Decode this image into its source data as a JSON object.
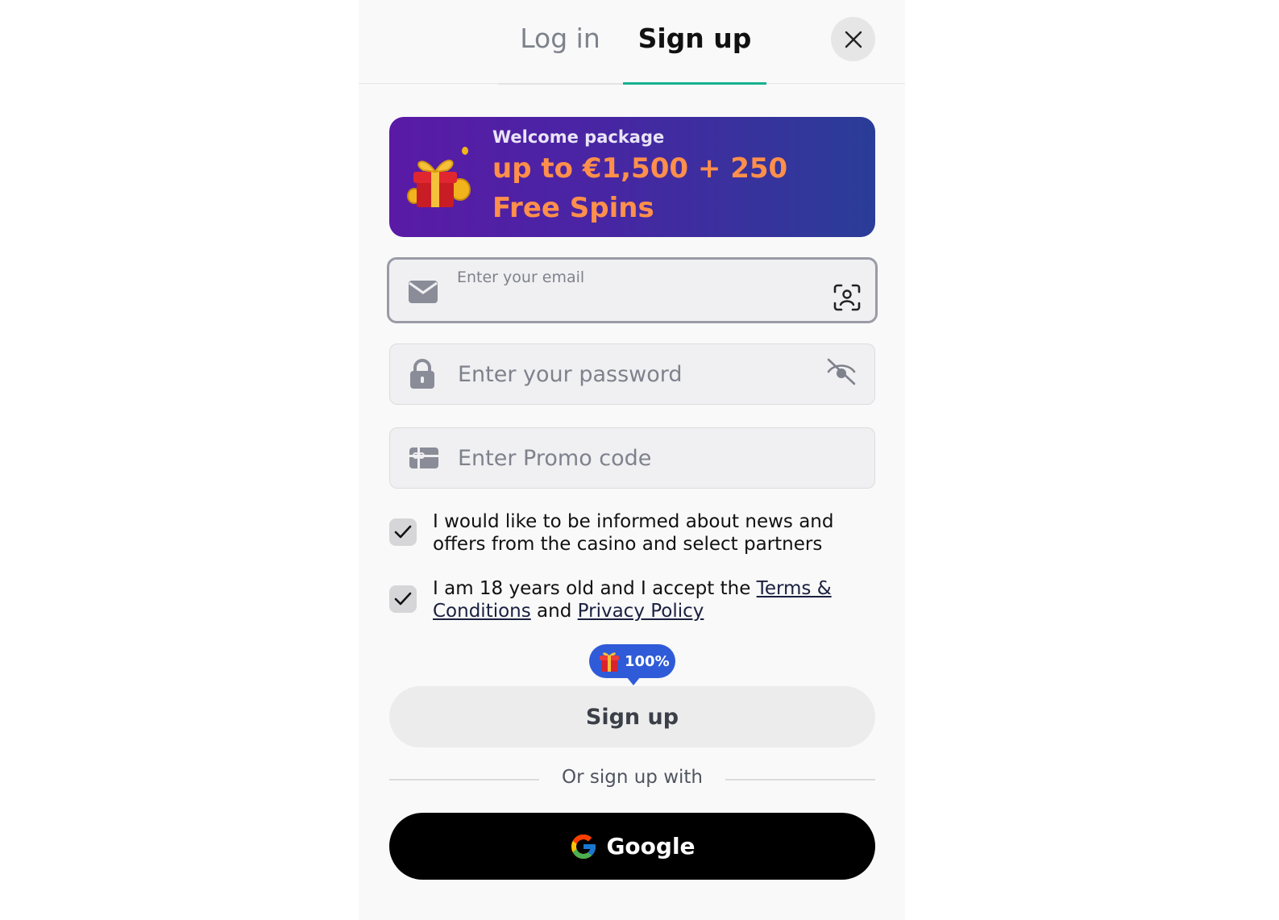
{
  "tabs": {
    "login_label": "Log in",
    "signup_label": "Sign up"
  },
  "banner": {
    "kicker": "Welcome package",
    "headline": "up to €1,500 + 250 Free Spins"
  },
  "email": {
    "label": "Enter your email",
    "value": ""
  },
  "password": {
    "placeholder": "Enter your password"
  },
  "promo": {
    "placeholder": "Enter Promo code"
  },
  "consents": {
    "news": {
      "text": "I would like to be informed about news and offers from the casino and select partners",
      "checked": true
    },
    "age": {
      "text_before": "I am 18 years old and I accept the ",
      "terms_link": "Terms & Conditions",
      "text_middle": " and ",
      "privacy_link": "Privacy Policy",
      "checked": true
    }
  },
  "bonus_bubble": {
    "percent": "100%"
  },
  "signup_button": {
    "label": "Sign up"
  },
  "divider": {
    "label": "Or sign up with"
  },
  "google_button": {
    "label": "Google"
  },
  "icons": {
    "close": "close-icon",
    "email": "envelope-icon",
    "face": "face-id-icon",
    "password": "lock-icon",
    "eye": "eye-off-icon",
    "promo": "gift-card-icon",
    "checkbox": "check-icon",
    "google": "google-logo-icon"
  },
  "colors": {
    "accent_tab": "#17b18e",
    "banner_gradient_start": "#5a1aa6",
    "banner_gradient_end": "#2a3d98",
    "banner_headline": "#ff8f4a",
    "bubble": "#2f5bd9",
    "google_button": "#000000"
  }
}
